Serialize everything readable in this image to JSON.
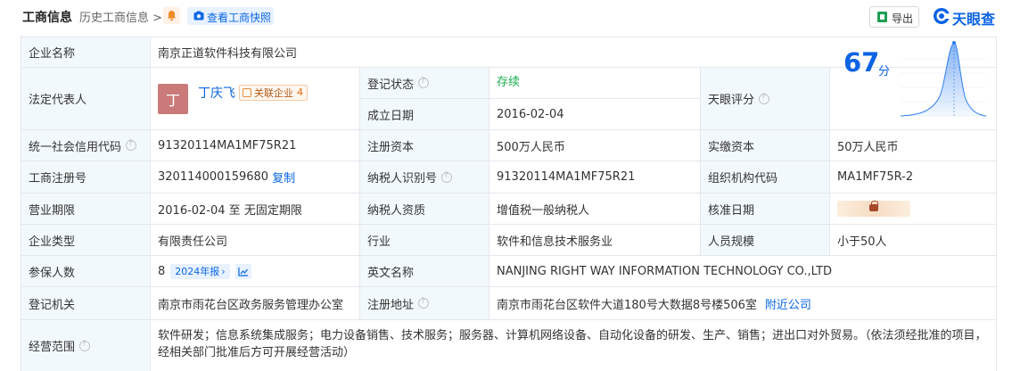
{
  "header": {
    "title": "工商信息",
    "history": "历史工商信息",
    "history_arrow": ">",
    "snapshot_label": "查看工商快照",
    "export_label": "导出",
    "logo_text": "天眼查"
  },
  "company": {
    "name_label": "企业名称",
    "name": "南京正道软件科技有限公司",
    "legal_rep_label": "法定代表人",
    "legal_rep_avatar": "丁",
    "legal_rep_name": "丁庆飞",
    "related_label": "关联企业",
    "related_count": "4",
    "reg_status_label": "登记状态",
    "reg_status": "存续",
    "est_date_label": "成立日期",
    "est_date": "2016-02-04",
    "score_label": "天眼评分",
    "score": "67",
    "score_unit": "分",
    "credit_code_label": "统一社会信用代码",
    "credit_code": "91320114MA1MF75R21",
    "reg_capital_label": "注册资本",
    "reg_capital": "500万人民币",
    "paid_capital_label": "实缴资本",
    "paid_capital": "50万人民币",
    "reg_no_label": "工商注册号",
    "reg_no": "320114000159680",
    "copy_label": "复制",
    "taxpayer_id_label": "纳税人识别号",
    "taxpayer_id": "91320114MA1MF75R21",
    "org_code_label": "组织机构代码",
    "org_code": "MA1MF75R-2",
    "term_label": "营业期限",
    "term": "2016-02-04 至 无固定期限",
    "taxpayer_qual_label": "纳税人资质",
    "taxpayer_qual": "增值税一般纳税人",
    "approve_date_label": "核准日期",
    "type_label": "企业类型",
    "type": "有限责任公司",
    "industry_label": "行业",
    "industry": "软件和信息技术服务业",
    "staff_label": "人员规模",
    "staff": "小于50人",
    "insured_label": "参保人数",
    "insured": "8",
    "report_badge": "2024年报",
    "report_arrow": "›",
    "en_name_label": "英文名称",
    "en_name": "NANJING RIGHT WAY INFORMATION TECHNOLOGY CO.,LTD",
    "authority_label": "登记机关",
    "authority": "南京市雨花台区政务服务管理办公室",
    "address_label": "注册地址",
    "address": "南京市雨花台区软件大道180号大数据8号楼506室",
    "nearby_label": "附近公司",
    "scope_label": "经营范围",
    "scope": "软件研发；信息系统集成服务；电力设备销售、技术服务；服务器、计算机网络设备、自动化设备的研发、生产、销售；进出口对外贸易。（依法须经批准的项目，经相关部门批准后方可开展经营活动）"
  },
  "colors": {
    "accent": "#0b66e4",
    "label_bg": "#f2f9fc",
    "status_green": "#1aad50",
    "border": "#e4e7ed"
  }
}
